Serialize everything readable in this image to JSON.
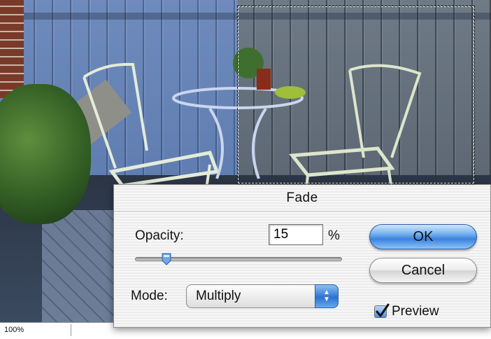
{
  "dialog": {
    "title": "Fade",
    "opacity_label": "Opacity:",
    "opacity_value": "15",
    "opacity_unit": "%",
    "opacity_fraction": 0.15,
    "mode_label": "Mode:",
    "mode_value": "Multiply",
    "ok_label": "OK",
    "cancel_label": "Cancel",
    "preview_label": "Preview",
    "preview_checked": true
  },
  "statusbar": {
    "zoom": "100%"
  },
  "colors": {
    "accent": "#3b83df",
    "selection_marquee": "#000000"
  },
  "icons": {
    "slider_thumb": "slider-thumb-icon",
    "select_arrows": "updown-arrows-icon",
    "checkmark": "checkmark-icon"
  }
}
